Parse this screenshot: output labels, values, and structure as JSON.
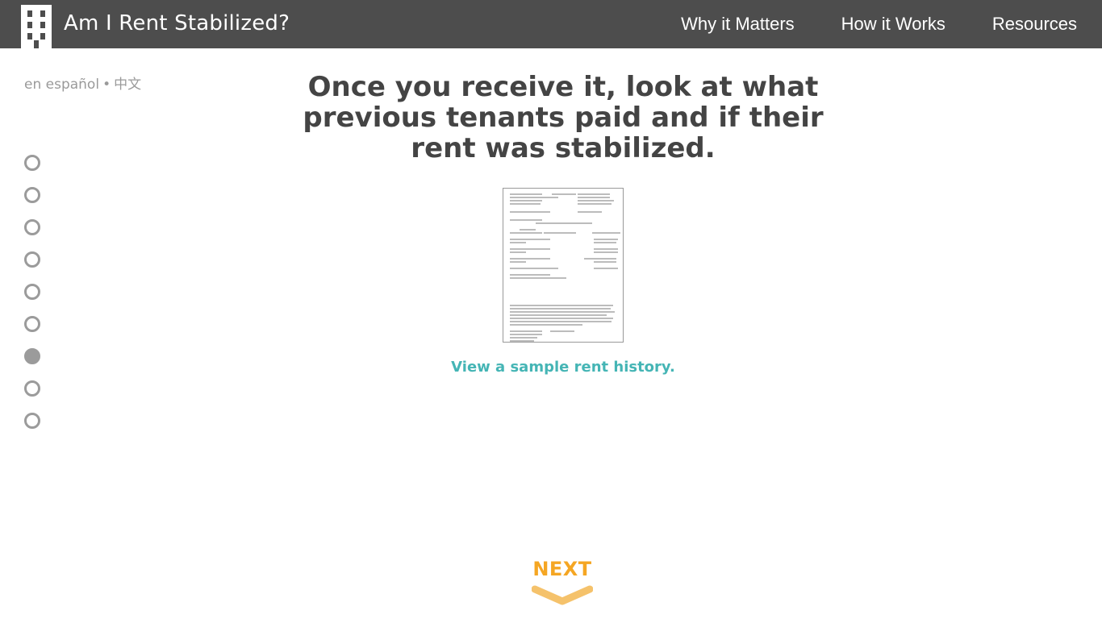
{
  "header": {
    "site_title": "Am I Rent Stabilized?",
    "logo_icon": "building-icon",
    "background": "#4d4d4d",
    "nav": [
      {
        "label": "Why it Matters"
      },
      {
        "label": "How it Works"
      },
      {
        "label": "Resources"
      }
    ]
  },
  "language": {
    "spanish": "en español",
    "separator": "•",
    "chinese": "中文"
  },
  "steps": {
    "total": 9,
    "active_index": 6
  },
  "main": {
    "heading": "Once you receive it, look at what previous tenants paid and if their rent was stabilized.",
    "document_icon": "rent-history-document-thumbnail",
    "sample_link": "View a sample rent history."
  },
  "next": {
    "label": "NEXT",
    "icon": "chevron-down-icon",
    "color": "#f5a623"
  },
  "colors": {
    "link_teal": "#45b5b5",
    "dot_gray": "#9b9b9b"
  }
}
